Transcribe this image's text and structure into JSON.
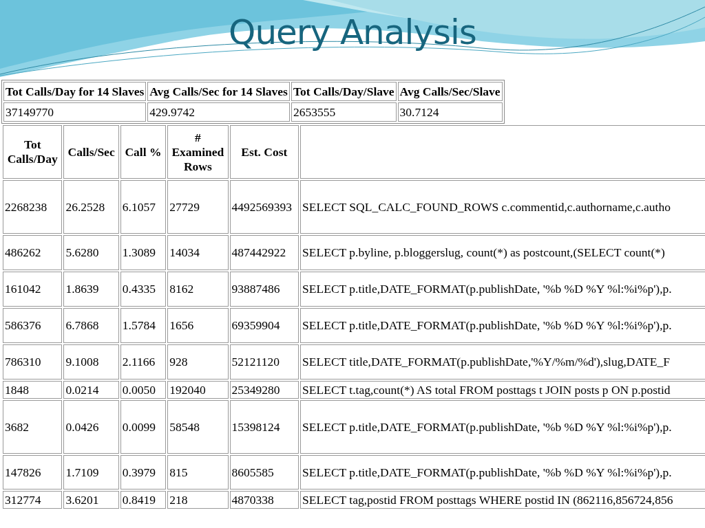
{
  "slide": {
    "title": "Query Analysis"
  },
  "summary_table": {
    "columns": [
      "Tot Calls/Day for 14 Slaves",
      "Avg Calls/Sec for 14 Slaves",
      "Tot Calls/Day/Slave",
      "Avg Calls/Sec/Slave"
    ],
    "values": [
      "37149770",
      "429.9742",
      "2653555",
      "30.7124"
    ]
  },
  "query_table": {
    "columns": [
      "Tot Calls/Day",
      "Calls/Sec",
      "Call %",
      "# Examined Rows",
      "Est. Cost"
    ],
    "rows": [
      [
        "2268238",
        "26.2528",
        "6.1057",
        "27729",
        "4492569393",
        "SELECT SQL_CALC_FOUND_ROWS c.commentid,c.authorname,c.autho"
      ],
      [
        "486262",
        "5.6280",
        "1.3089",
        "14034",
        "487442922",
        "SELECT p.byline, p.bloggerslug, count(*) as postcount,(SELECT count(*)"
      ],
      [
        "161042",
        "1.8639",
        "0.4335",
        "8162",
        "93887486",
        "SELECT p.title,DATE_FORMAT(p.publishDate, '%b %D %Y %l:%i%p'),p."
      ],
      [
        "586376",
        "6.7868",
        "1.5784",
        "1656",
        "69359904",
        "SELECT p.title,DATE_FORMAT(p.publishDate, '%b %D %Y %l:%i%p'),p."
      ],
      [
        "786310",
        "9.1008",
        "2.1166",
        "928",
        "52121120",
        "SELECT title,DATE_FORMAT(p.publishDate,'%Y/%m/%d'),slug,DATE_F"
      ],
      [
        "1848",
        "0.0214",
        "0.0050",
        "192040",
        "25349280",
        "SELECT t.tag,count(*) AS total FROM posttags t JOIN posts p ON p.postid"
      ],
      [
        "3682",
        "0.0426",
        "0.0099",
        "58548",
        "15398124",
        "SELECT p.title,DATE_FORMAT(p.publishDate, '%b %D %Y %l:%i%p'),p."
      ],
      [
        "147826",
        "1.7109",
        "0.3979",
        "815",
        "8605585",
        "SELECT p.title,DATE_FORMAT(p.publishDate, '%b %D %Y %l:%i%p'),p."
      ],
      [
        "312774",
        "3.6201",
        "0.8419",
        "218",
        "4870338",
        "SELECT tag,postid FROM posttags WHERE postid IN (862116,856724,856"
      ]
    ]
  }
}
